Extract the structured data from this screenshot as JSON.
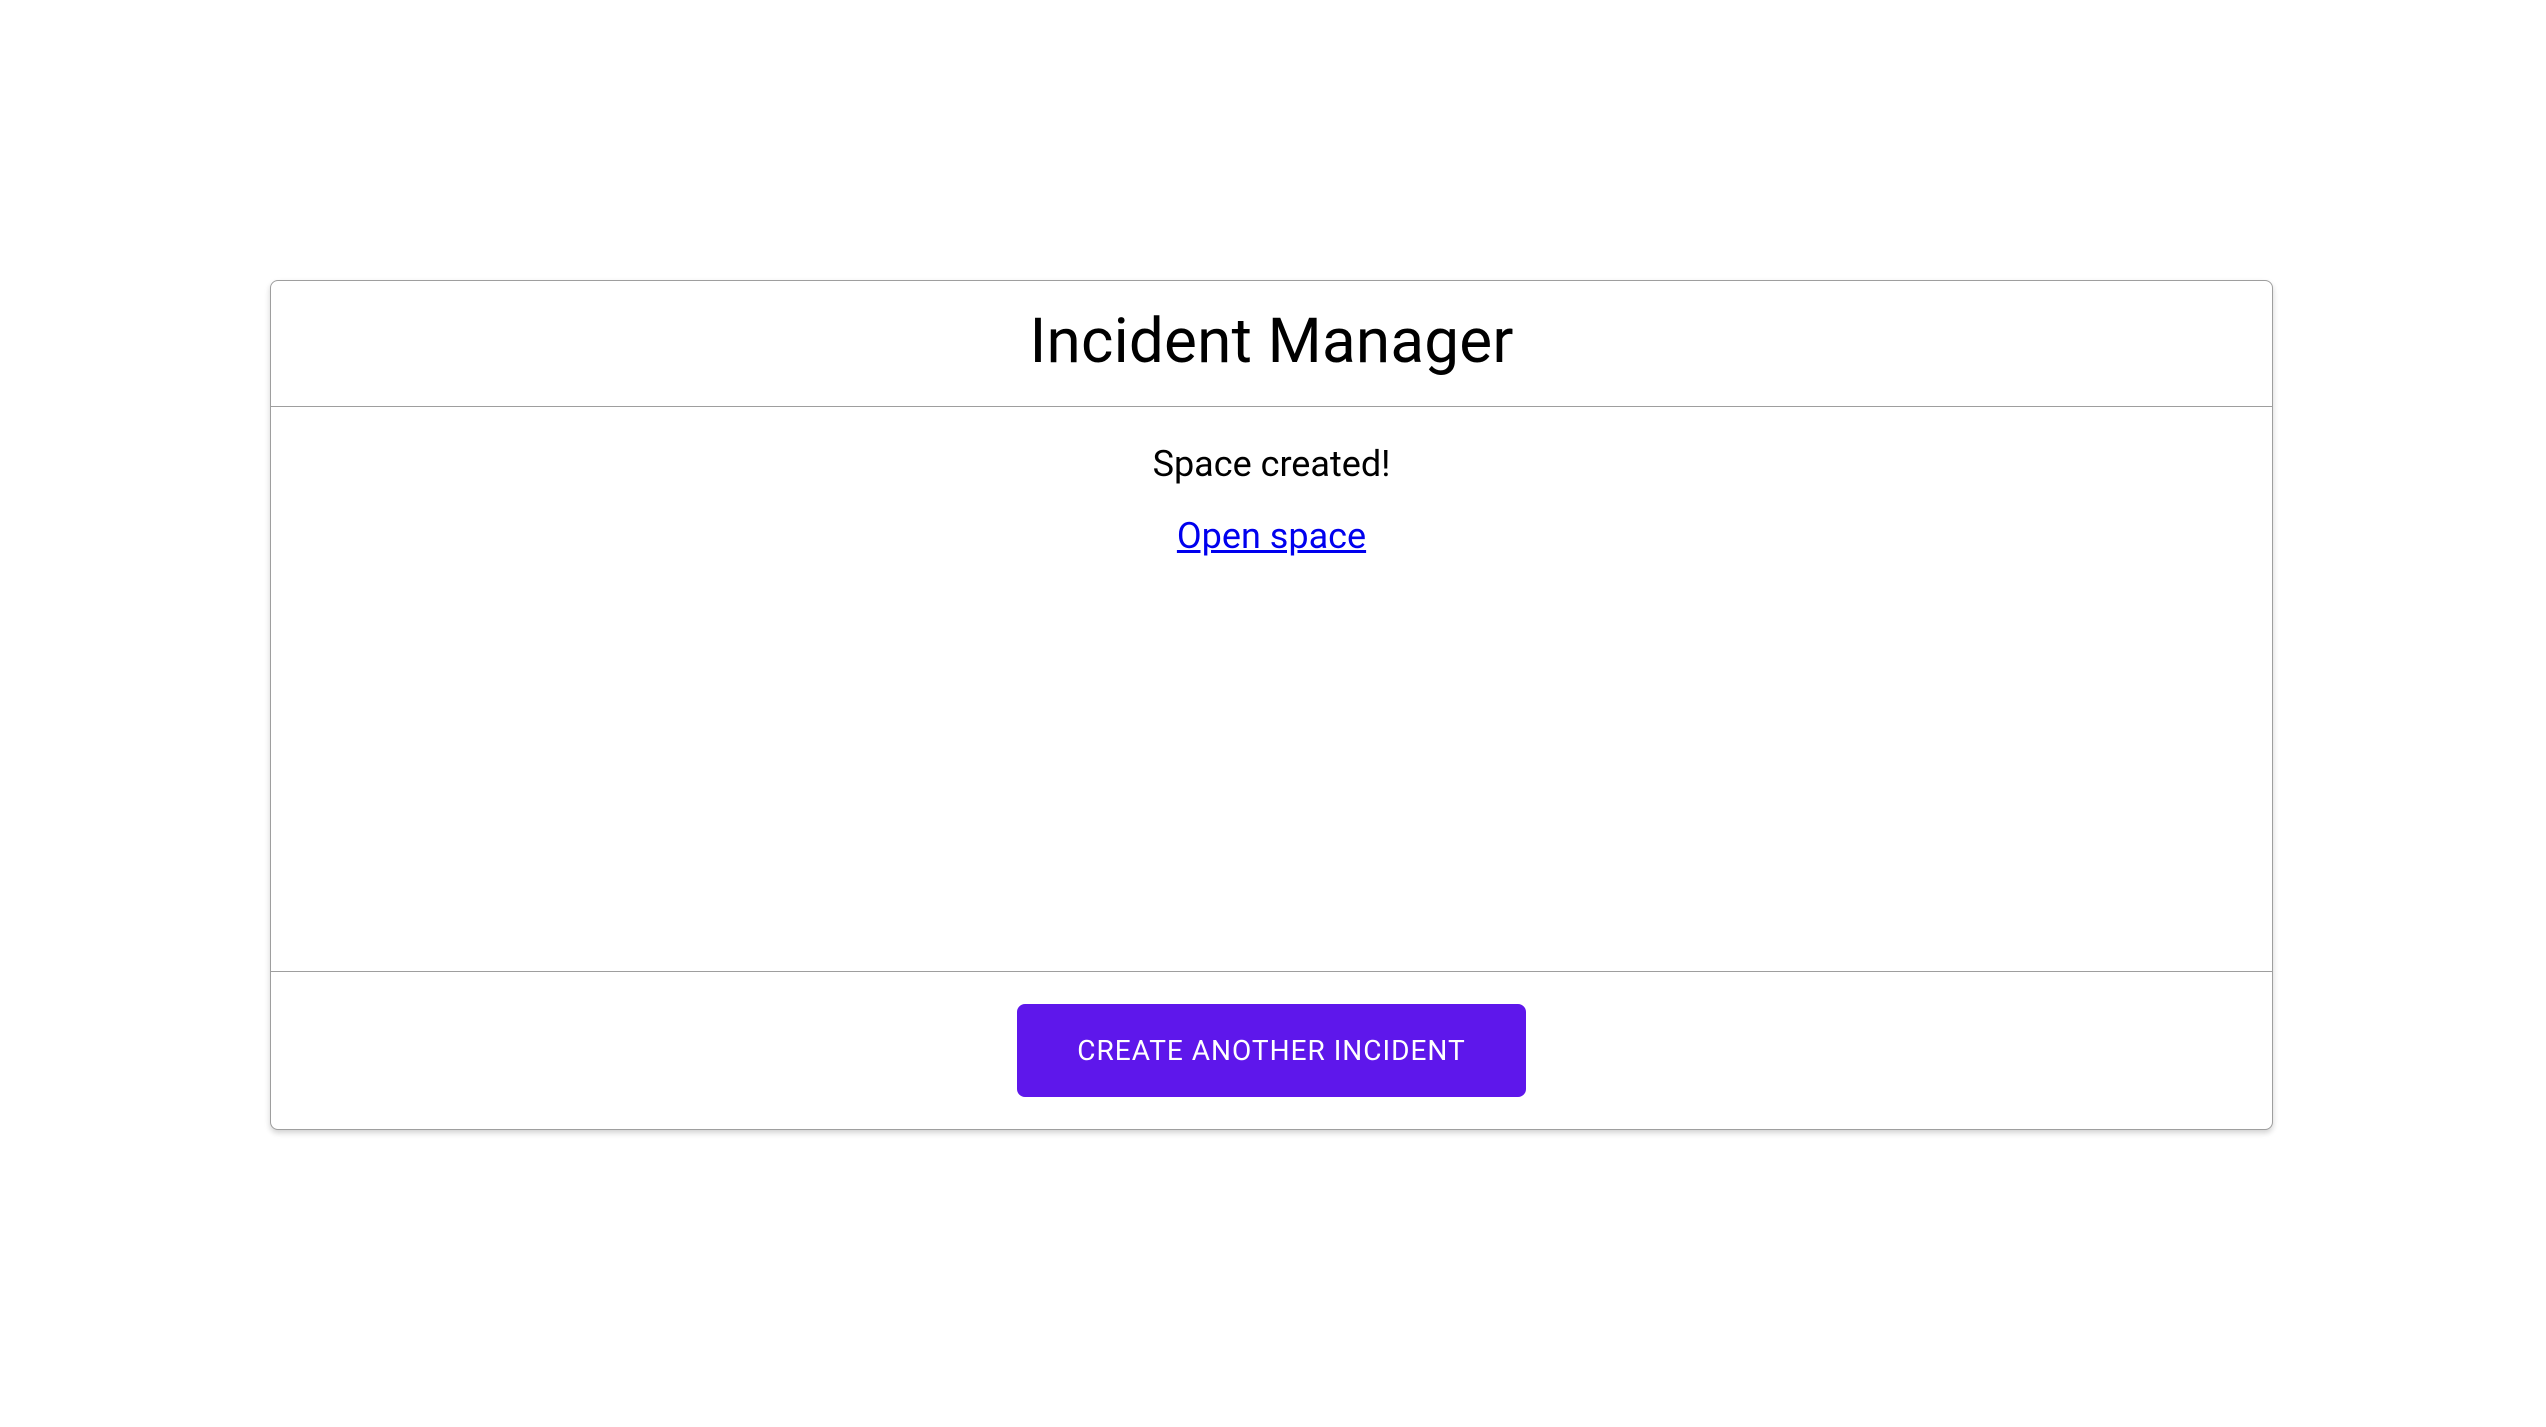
{
  "header": {
    "title": "Incident Manager"
  },
  "body": {
    "status_message": "Space created!",
    "open_link_label": "Open space"
  },
  "footer": {
    "button_label": "CREATE ANOTHER INCIDENT"
  },
  "colors": {
    "primary": "#5E17EB",
    "border": "#9e9e9e",
    "link": "#0000EE"
  }
}
